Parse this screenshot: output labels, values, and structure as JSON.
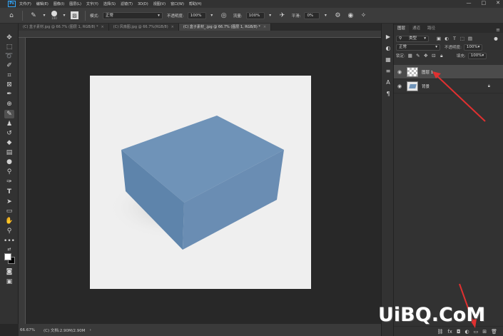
{
  "menu": {
    "logo": "Ps",
    "items": [
      "文件(F)",
      "编辑(E)",
      "图像(I)",
      "图层(L)",
      "文字(Y)",
      "选择(S)",
      "滤镜(T)",
      "3D(D)",
      "视图(V)",
      "窗口(W)",
      "帮助(H)"
    ],
    "window_buttons": [
      "—",
      "□",
      "✕"
    ]
  },
  "options": {
    "brush_size": "100",
    "mode_label": "模式:",
    "mode_value": "正常",
    "opacity_label": "不透明度:",
    "opacity_value": "100%",
    "flow_label": "流量:",
    "flow_value": "100%",
    "smooth_label": "平滑:",
    "smooth_value": "0%"
  },
  "tabs": [
    {
      "label": "(C) 盒子素材.jpg @ 66.7% (图层 1, RGB/8) *",
      "active": false
    },
    {
      "label": "(C) 风扇图.jpg @ 66.7%(RGB/8)",
      "active": false
    },
    {
      "label": "(C) 盒子素材_.jpg @ 66.7% (图层 1, RGB/8) *",
      "active": true
    }
  ],
  "status": {
    "zoom": "66.67%",
    "doc": "(C) 文档:2.90M/2.90M"
  },
  "panel": {
    "tabs": [
      "图层",
      "通道",
      "路径"
    ],
    "filter_label": "类型",
    "blend_mode": "正常",
    "opacity_label": "不透明度:",
    "opacity_value": "100%",
    "lock_label": "锁定:",
    "fill_label": "填充:",
    "fill_value": "100%",
    "layers": [
      {
        "name": "图层 1",
        "selected": true
      },
      {
        "name": "背景",
        "selected": false
      }
    ]
  },
  "watermark": "UiBQ.CoM",
  "colors": {
    "box_top": "#6f93b8",
    "box_front": "#6a8db3",
    "box_side": "#5a7fa6",
    "arrow": "#e03030"
  }
}
